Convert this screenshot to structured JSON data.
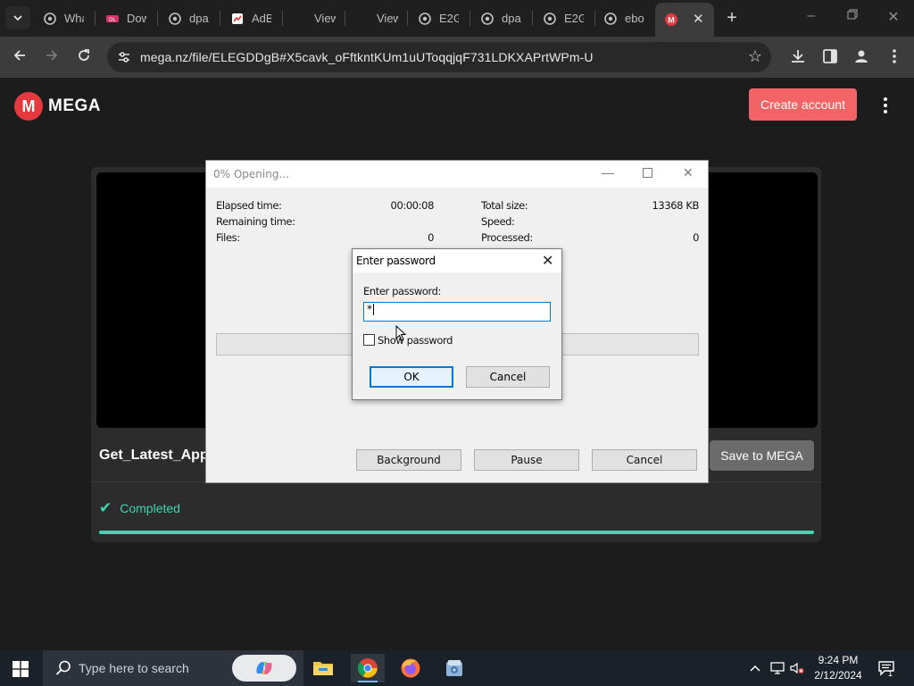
{
  "browser": {
    "tabs": [
      {
        "title": "Wha",
        "icon": "globe-icon"
      },
      {
        "title": "Dow",
        "icon": "pink-site-icon"
      },
      {
        "title": "dpa",
        "icon": "globe-icon"
      },
      {
        "title": "AdB",
        "icon": "image-site-icon"
      },
      {
        "title": "View",
        "icon": "blank-icon"
      },
      {
        "title": "View",
        "icon": "blank-icon"
      },
      {
        "title": "E2G",
        "icon": "globe-icon"
      },
      {
        "title": "dpa",
        "icon": "globe-icon"
      },
      {
        "title": "E2G",
        "icon": "globe-icon"
      },
      {
        "title": "ebo",
        "icon": "globe-icon"
      }
    ],
    "active_tab_icon": "mega-icon",
    "url": "mega.nz/file/ELEGDDgB#X5cavk_oFftkntKUm1uUToqqjqF731LDKXAPrtWPm-U"
  },
  "mega": {
    "logo_text": "MEGA",
    "logo_letter": "M",
    "create_account": "Create account",
    "filename": "Get_Latest_App_",
    "save_button": "Save to MEGA",
    "status": "Completed",
    "progress_fraction": 1.0
  },
  "extract_window": {
    "title": "0% Opening...",
    "labels": {
      "elapsed": "Elapsed time:",
      "remaining": "Remaining time:",
      "files": "Files:",
      "total_size": "Total size:",
      "speed": "Speed:",
      "processed": "Processed:"
    },
    "values": {
      "elapsed": "00:00:08",
      "files": "0",
      "total_size": "13368 KB",
      "processed": "0"
    },
    "buttons": {
      "background": "Background",
      "pause": "Pause",
      "cancel": "Cancel"
    }
  },
  "password_dialog": {
    "title": "Enter password",
    "label": "Enter password:",
    "value": "*",
    "show_password": "Show password",
    "ok": "OK",
    "cancel": "Cancel"
  },
  "taskbar": {
    "search_placeholder": "Type here to search",
    "time": "9:24 PM",
    "date": "2/12/2024",
    "notification_count": "1"
  },
  "colors": {
    "mega_red": "#e5383f",
    "create_button": "#f46466",
    "completed_green": "#3cd6b0",
    "win_accent": "#0078d7"
  }
}
